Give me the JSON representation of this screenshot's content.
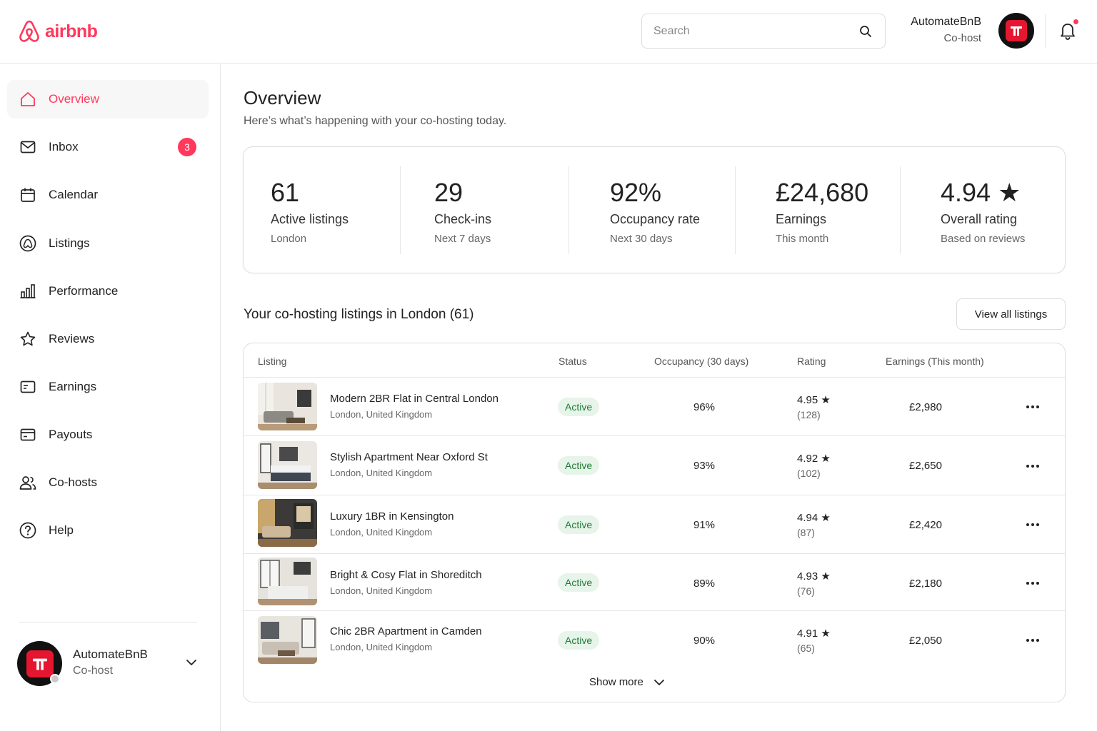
{
  "header": {
    "logo_text": "airbnb",
    "search_placeholder": "Search",
    "user_name": "AutomateBnB",
    "user_role": "Co-host"
  },
  "sidebar": {
    "items": [
      {
        "label": "Overview",
        "icon": "home-icon",
        "active": true
      },
      {
        "label": "Inbox",
        "icon": "mail-icon",
        "badge": "3"
      },
      {
        "label": "Calendar",
        "icon": "calendar-icon"
      },
      {
        "label": "Listings",
        "icon": "listings-icon"
      },
      {
        "label": "Performance",
        "icon": "bar-chart-icon"
      },
      {
        "label": "Reviews",
        "icon": "star-icon"
      },
      {
        "label": "Earnings",
        "icon": "earnings-icon"
      },
      {
        "label": "Payouts",
        "icon": "card-icon"
      },
      {
        "label": "Co-hosts",
        "icon": "users-icon"
      },
      {
        "label": "Help",
        "icon": "help-icon"
      }
    ],
    "user": {
      "name": "AutomateBnB",
      "role": "Co-host"
    }
  },
  "main": {
    "title": "Overview",
    "subtitle": "Here’s what’s happening with your co-hosting today.",
    "stats": [
      {
        "value": "61",
        "label": "Active listings",
        "sub": "London"
      },
      {
        "value": "29",
        "label": "Check-ins",
        "sub": "Next 7 days"
      },
      {
        "value": "92%",
        "label": "Occupancy rate",
        "sub": "Next 30 days"
      },
      {
        "value": "£24,680",
        "label": "Earnings",
        "sub": "This month"
      },
      {
        "value": "4.94 ★",
        "label": "Overall rating",
        "sub": "Based on reviews"
      }
    ],
    "listings_title": "Your co-hosting listings in London (61)",
    "view_all": "View all listings",
    "table": {
      "headers": [
        "Listing",
        "Status",
        "Occupancy (30 days)",
        "Rating",
        "Earnings (This month)"
      ],
      "rows": [
        {
          "title": "Modern 2BR Flat in Central London",
          "location": "London, United Kingdom",
          "status": "Active",
          "occupancy": "96%",
          "rating": "4.95 ★",
          "reviews": "(128)",
          "earnings": "£2,980"
        },
        {
          "title": "Stylish Apartment Near Oxford St",
          "location": "London, United Kingdom",
          "status": "Active",
          "occupancy": "93%",
          "rating": "4.92 ★",
          "reviews": "(102)",
          "earnings": "£2,650"
        },
        {
          "title": "Luxury 1BR in Kensington",
          "location": "London, United Kingdom",
          "status": "Active",
          "occupancy": "91%",
          "rating": "4.94 ★",
          "reviews": "(87)",
          "earnings": "£2,420"
        },
        {
          "title": "Bright & Cosy Flat in Shoreditch",
          "location": "London, United Kingdom",
          "status": "Active",
          "occupancy": "89%",
          "rating": "4.93 ★",
          "reviews": "(76)",
          "earnings": "£2,180"
        },
        {
          "title": "Chic 2BR Apartment in Camden",
          "location": "London, United Kingdom",
          "status": "Active",
          "occupancy": "90%",
          "rating": "4.91 ★",
          "reviews": "(65)",
          "earnings": "£2,050"
        }
      ],
      "show_more": "Show more"
    }
  },
  "colors": {
    "brand": "#ff385c",
    "active_bg": "#e7f4ea",
    "active_text": "#1e7a34"
  }
}
